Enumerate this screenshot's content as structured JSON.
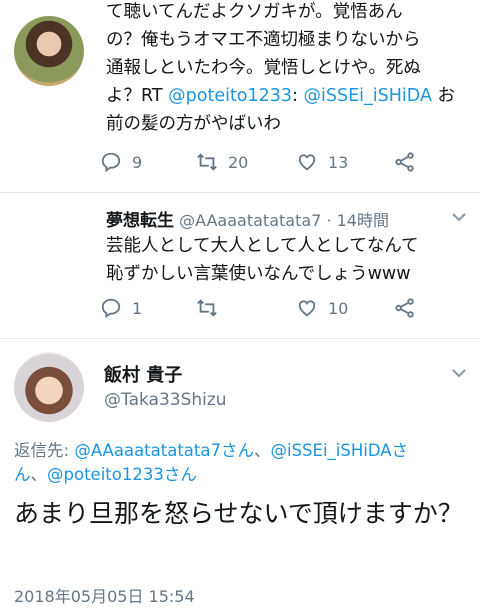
{
  "tweet1": {
    "text_line0": "……………………",
    "text_line1": "て聴いてんだよクソガキが。覚悟あん",
    "text_line2": "の？俺もうオマエ不適切極まりないから",
    "text_line3": "通報しといたわ今。覚悟しとけや。死ぬ",
    "text_line4_pre": "よ？RT ",
    "text_line4_link1": "@poteito1233",
    "text_line4_mid": ": ",
    "text_line4_link2": "@iSSEi_iSHiDA",
    "text_line4_post": " お",
    "text_line5": "前の髪の方がやばいわ",
    "reply_count": "9",
    "retweet_count": "20",
    "like_count": "13"
  },
  "tweet2": {
    "name": "夢想転生",
    "handle": "@AAaaatatatata7",
    "dot": "·",
    "time": "14時間",
    "text_line1": "芸能人として大人として人としてなんて",
    "text_line2": "恥ずかしい言葉使いなんでしょうwww",
    "reply_count": "1",
    "retweet_count": "",
    "like_count": "10"
  },
  "tweet3": {
    "name": "飯村 貴子",
    "handle": "@Taka33Shizu",
    "reply_prefix": "返信先: ",
    "reply_link1": "@AAaaatatatata7さん",
    "reply_sep1": "、",
    "reply_link2": "@iSSEi_iSHiDAさ",
    "reply_line2_link": "ん",
    "reply_sep2": "、",
    "reply_link3": "@poteito1233さん",
    "text": "あまり旦那を怒らせないで頂けますか？",
    "date": "2018年05月05日 15:54"
  },
  "icons": [
    "reply-icon",
    "retweet-icon",
    "like-icon",
    "share-icon",
    "chevron-down-icon"
  ],
  "colors": {
    "link": "#1b95e0",
    "muted": "#657786",
    "text": "#14171a",
    "divider": "#e1e8ed"
  }
}
